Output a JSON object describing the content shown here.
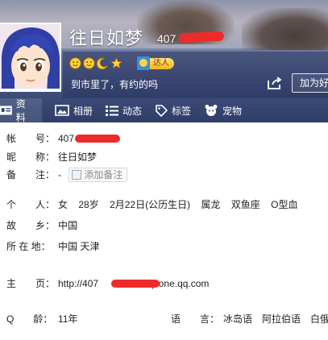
{
  "profile": {
    "name": "往日如梦",
    "qq_prefix": "407",
    "signature": "到市里了，有约的吗",
    "talent_label": "达人",
    "add_friend_label": "加为好",
    "badges": [
      "smile-icon",
      "smile-icon",
      "moon-icon",
      "star-icon"
    ]
  },
  "tabs": [
    {
      "label": "资料",
      "icon": "profile-card-icon",
      "active": true
    },
    {
      "label": "相册",
      "icon": "photo-icon",
      "active": false
    },
    {
      "label": "动态",
      "icon": "list-icon",
      "active": false
    },
    {
      "label": "标签",
      "icon": "tag-icon",
      "active": false
    },
    {
      "label": "宠物",
      "icon": "pet-icon",
      "active": false
    }
  ],
  "details": {
    "account": {
      "label": "帐　　号：",
      "value": "407"
    },
    "nickname": {
      "label": "昵　　称：",
      "value": "往日如梦"
    },
    "remark": {
      "label": "备　　注：",
      "value": "-",
      "button": "添加备注"
    },
    "personal": {
      "label": "个　　人：",
      "gender": "女",
      "age": "28岁",
      "birthday": "2月22日(公历生日)",
      "zodiac": "属龙",
      "star_sign": "双鱼座",
      "blood": "O型血"
    },
    "hometown": {
      "label": "故　　乡：",
      "value": "中国"
    },
    "location": {
      "label": "所 在 地：",
      "value": "中国 天津"
    },
    "homepage": {
      "label": "主　　页：",
      "prefix": "http://407",
      "suffix": "qzone.qq.com"
    },
    "qage": {
      "label": "Q　　龄：",
      "value": "11年"
    },
    "language": {
      "label": "语　　言：",
      "values": "冰岛语　阿拉伯语　白俄罗"
    }
  },
  "colors": {
    "tabbar": "#2f3d68",
    "redaction": "#ee2b2b",
    "talent": "#f4b420"
  }
}
